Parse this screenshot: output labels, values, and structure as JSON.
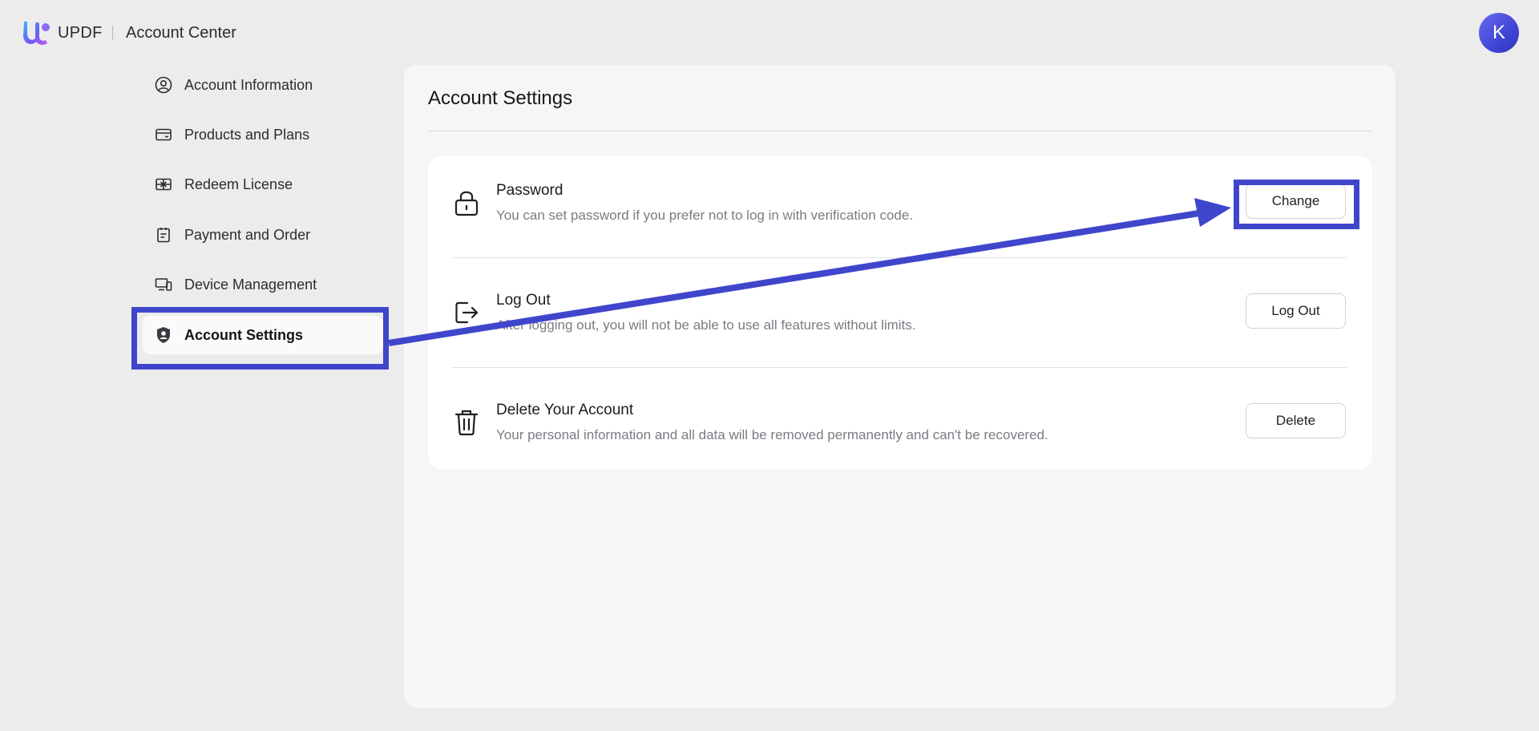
{
  "header": {
    "brand": "UPDF",
    "title": "Account Center",
    "avatar_initial": "K"
  },
  "sidebar": {
    "items": [
      {
        "label": "Account Information",
        "icon": "user-circle-icon"
      },
      {
        "label": "Products and Plans",
        "icon": "card-icon"
      },
      {
        "label": "Redeem License",
        "icon": "gift-icon"
      },
      {
        "label": "Payment and Order",
        "icon": "receipt-icon"
      },
      {
        "label": "Device Management",
        "icon": "devices-icon"
      },
      {
        "label": "Account Settings",
        "icon": "shield-user-icon",
        "active": true
      }
    ]
  },
  "main": {
    "title": "Account Settings",
    "sections": [
      {
        "title": "Password",
        "description": "You can set password if you prefer not to log in with verification code.",
        "button": "Change",
        "icon": "lock-icon"
      },
      {
        "title": "Log Out",
        "description": "After logging out, you will not be able to use all features without limits.",
        "button": "Log Out",
        "icon": "logout-icon"
      },
      {
        "title": "Delete Your Account",
        "description": "Your personal information and all data will be removed permanently and can't be recovered.",
        "button": "Delete",
        "icon": "trash-icon"
      }
    ]
  },
  "annotation": {
    "color": "#3f46cc"
  }
}
